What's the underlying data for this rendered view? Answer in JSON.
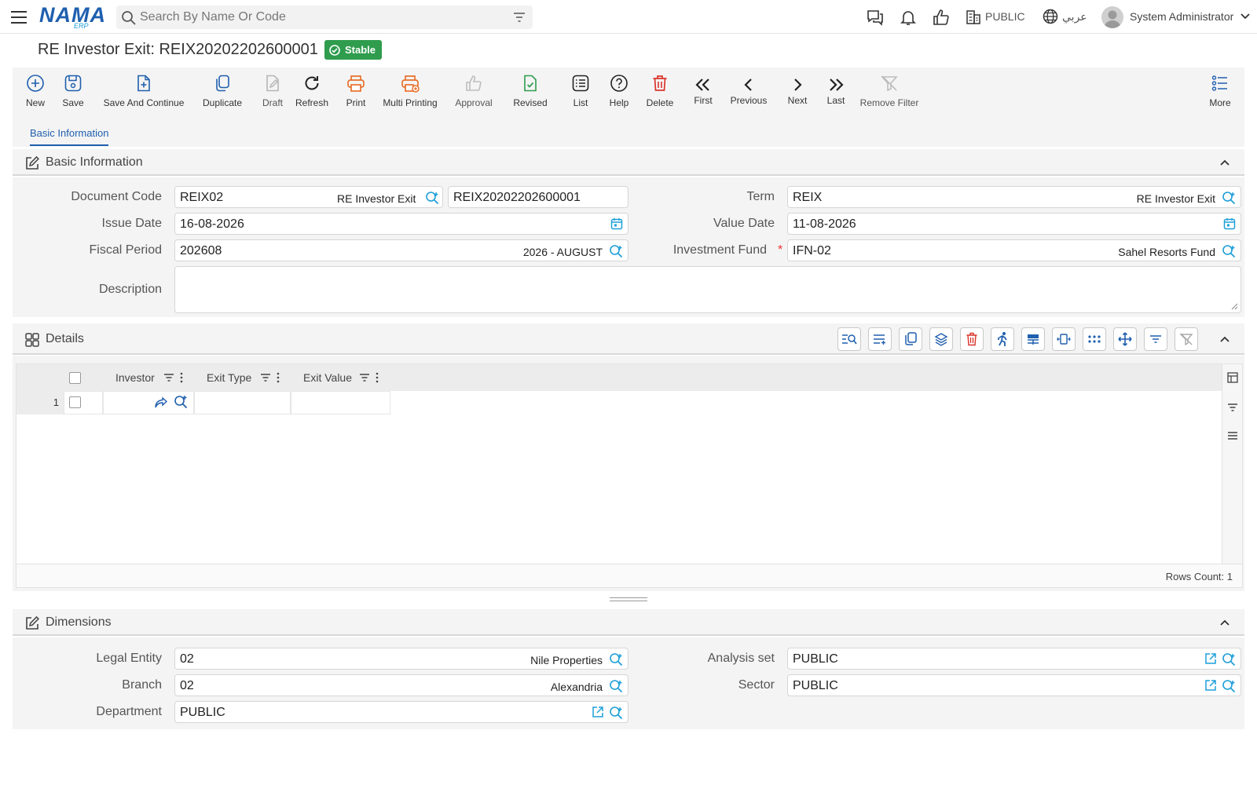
{
  "topbar": {
    "logo_main": "NAMA",
    "logo_sub": "ERP",
    "search_placeholder": "Search By Name Or Code",
    "company": "PUBLIC",
    "language": "عربي",
    "user_name": "System Administrator"
  },
  "page": {
    "title": "RE Investor Exit: REIX20202202600001",
    "status": "Stable",
    "status_color": "#2f9c4e"
  },
  "toolbar": {
    "new": "New",
    "save": "Save",
    "save_continue": "Save And Continue",
    "duplicate": "Duplicate",
    "draft": "Draft",
    "refresh": "Refresh",
    "print": "Print",
    "multi_printing": "Multi Printing",
    "approval": "Approval",
    "revised": "Revised",
    "list": "List",
    "help": "Help",
    "delete": "Delete",
    "first": "First",
    "previous": "Previous",
    "next": "Next",
    "last": "Last",
    "remove_filter": "Remove Filter",
    "more": "More"
  },
  "tabs": {
    "basic": "Basic Information"
  },
  "basic": {
    "section_title": "Basic Information",
    "document_code": {
      "label": "Document Code",
      "value": "REIX02",
      "desc": "RE Investor Exit",
      "code": "REIX20202202600001"
    },
    "term": {
      "label": "Term",
      "value": "REIX",
      "desc": "RE Investor Exit"
    },
    "issue_date": {
      "label": "Issue Date",
      "value": "16-08-2026"
    },
    "value_date": {
      "label": "Value Date",
      "value": "11-08-2026"
    },
    "fiscal_period": {
      "label": "Fiscal Period",
      "value": "202608",
      "desc": "2026 - AUGUST"
    },
    "investment_fund": {
      "label": "Investment Fund",
      "required": "*",
      "value": "IFN-02",
      "desc": "Sahel Resorts Fund"
    },
    "description": {
      "label": "Description",
      "value": ""
    }
  },
  "details": {
    "section_title": "Details",
    "columns": [
      "Investor",
      "Exit Type",
      "Exit Value"
    ],
    "rows": [
      {
        "num": "1",
        "investor": "",
        "exit_type": "",
        "exit_value": ""
      }
    ],
    "rows_count": "Rows Count: 1"
  },
  "dimensions": {
    "section_title": "Dimensions",
    "legal_entity": {
      "label": "Legal Entity",
      "value": "02",
      "desc": "Nile Properties"
    },
    "analysis_set": {
      "label": "Analysis set",
      "value": "PUBLIC"
    },
    "branch": {
      "label": "Branch",
      "value": "02",
      "desc": "Alexandria"
    },
    "sector": {
      "label": "Sector",
      "value": "PUBLIC"
    },
    "department": {
      "label": "Department",
      "value": "PUBLIC"
    }
  },
  "colors": {
    "primary": "#1f5fae",
    "accent": "#1f9fd8",
    "danger": "#d9342b",
    "print": "#e8702a",
    "success": "#2f9c4e"
  }
}
